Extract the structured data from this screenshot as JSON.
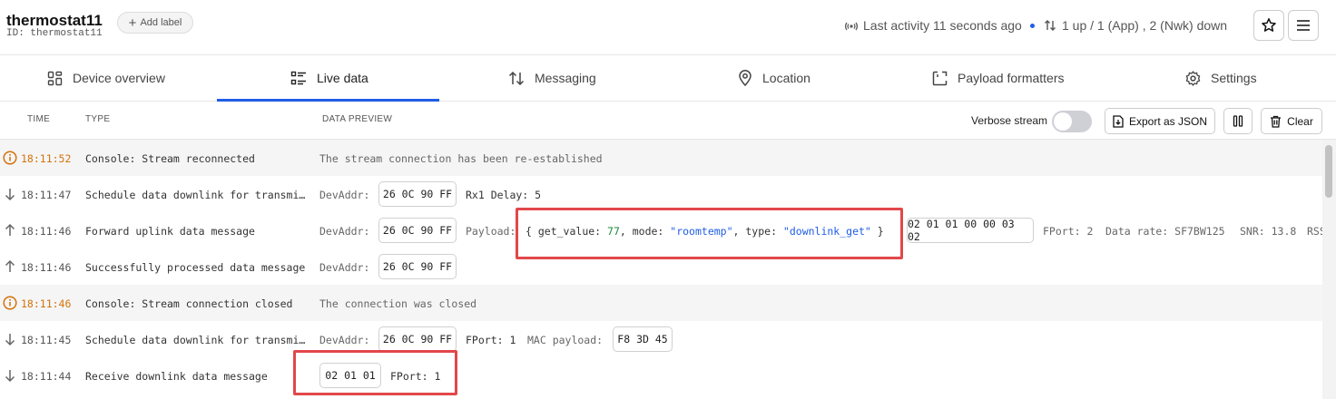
{
  "device": {
    "name": "thermostat11",
    "id": "ID: thermostat11",
    "add_label": "Add label"
  },
  "status": {
    "activity": "Last activity 11 seconds ago",
    "traffic": "1 up / 1 (App) , 2 (Nwk) down"
  },
  "tabs": [
    {
      "label": "Device overview",
      "icon": "grid-icon"
    },
    {
      "label": "Live data",
      "icon": "list-icon",
      "active": true
    },
    {
      "label": "Messaging",
      "icon": "up-down-arrows-icon"
    },
    {
      "label": "Location",
      "icon": "location-pin-icon"
    },
    {
      "label": "Payload formatters",
      "icon": "code-bracket-icon"
    },
    {
      "label": "Settings",
      "icon": "gear-icon"
    }
  ],
  "table": {
    "col_time": "TIME",
    "col_type": "TYPE",
    "col_preview": "DATA PREVIEW"
  },
  "toolbar": {
    "verbose": "Verbose stream",
    "verbose_on": false,
    "export": "Export as JSON",
    "clear": "Clear"
  },
  "events": [
    {
      "kind": "info",
      "time": "18:11:52",
      "type": "Console: Stream reconnected",
      "preview": "The stream connection has been re-established"
    },
    {
      "kind": "down",
      "time": "18:11:47",
      "type": "Schedule data downlink for transmission",
      "devaddr_label": "DevAddr:",
      "devaddr": "26 0C 90 FF",
      "extra": "Rx1 Delay: 5"
    },
    {
      "kind": "up",
      "time": "18:11:46",
      "type": "Forward uplink data message",
      "devaddr_label": "DevAddr:",
      "devaddr": "26 0C 90 FF",
      "payload_label": "Payload:",
      "payload": {
        "open": "{",
        "k1": " get_value: ",
        "v1": "77",
        "k2": ", mode: ",
        "v2": "\"roomtemp\"",
        "k3": ", type: ",
        "v3": "\"downlink_get\"",
        "close": " }"
      },
      "bytes": "02 01 01 00 00 03 02",
      "fport": "FPort: 2",
      "datarate": "Data rate: SF7BW125",
      "snr": "SNR: 13.8",
      "rssi": "RSS"
    },
    {
      "kind": "up",
      "time": "18:11:46",
      "type": "Successfully processed data message",
      "devaddr_label": "DevAddr:",
      "devaddr": "26 0C 90 FF"
    },
    {
      "kind": "info",
      "time": "18:11:46",
      "type": "Console: Stream connection closed",
      "preview": "The connection was closed"
    },
    {
      "kind": "down",
      "time": "18:11:45",
      "type": "Schedule data downlink for transmission",
      "devaddr_label": "DevAddr:",
      "devaddr": "26 0C 90 FF",
      "fport": "FPort: 1",
      "mac_label": "MAC payload:",
      "mac": "F8 3D 45"
    },
    {
      "kind": "down",
      "time": "18:11:44",
      "type": "Receive downlink data message",
      "bytes": "02 01 01",
      "fport": "FPort: 1"
    }
  ],
  "colors": {
    "accent": "#1f5de5",
    "warning": "#d4730a",
    "highlight": "#e2474a",
    "json_number": "#1e8a3e"
  }
}
